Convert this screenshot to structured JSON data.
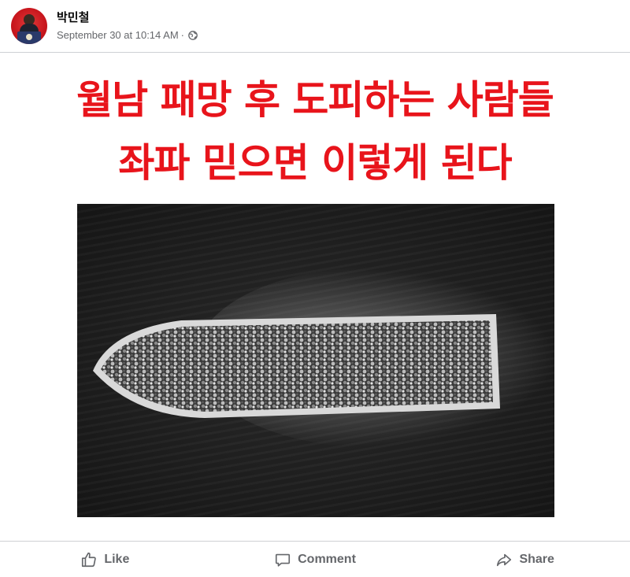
{
  "post": {
    "author": "박민철",
    "timestamp": "September 30 at 10:14 AM",
    "separator": "·",
    "audience_icon": "globe-icon"
  },
  "image": {
    "headline_line1": "월남 패망 후 도피하는 사람들",
    "headline_line2": "좌파 믿으면 이렇게 된다",
    "headline_color": "#e8141b",
    "photo_subject": "overcrowded refugee boat (black & white aerial photo)"
  },
  "actions": {
    "like_label": "Like",
    "comment_label": "Comment",
    "share_label": "Share"
  },
  "colors": {
    "meta_text": "#65676b",
    "divider": "#ced0d4"
  }
}
